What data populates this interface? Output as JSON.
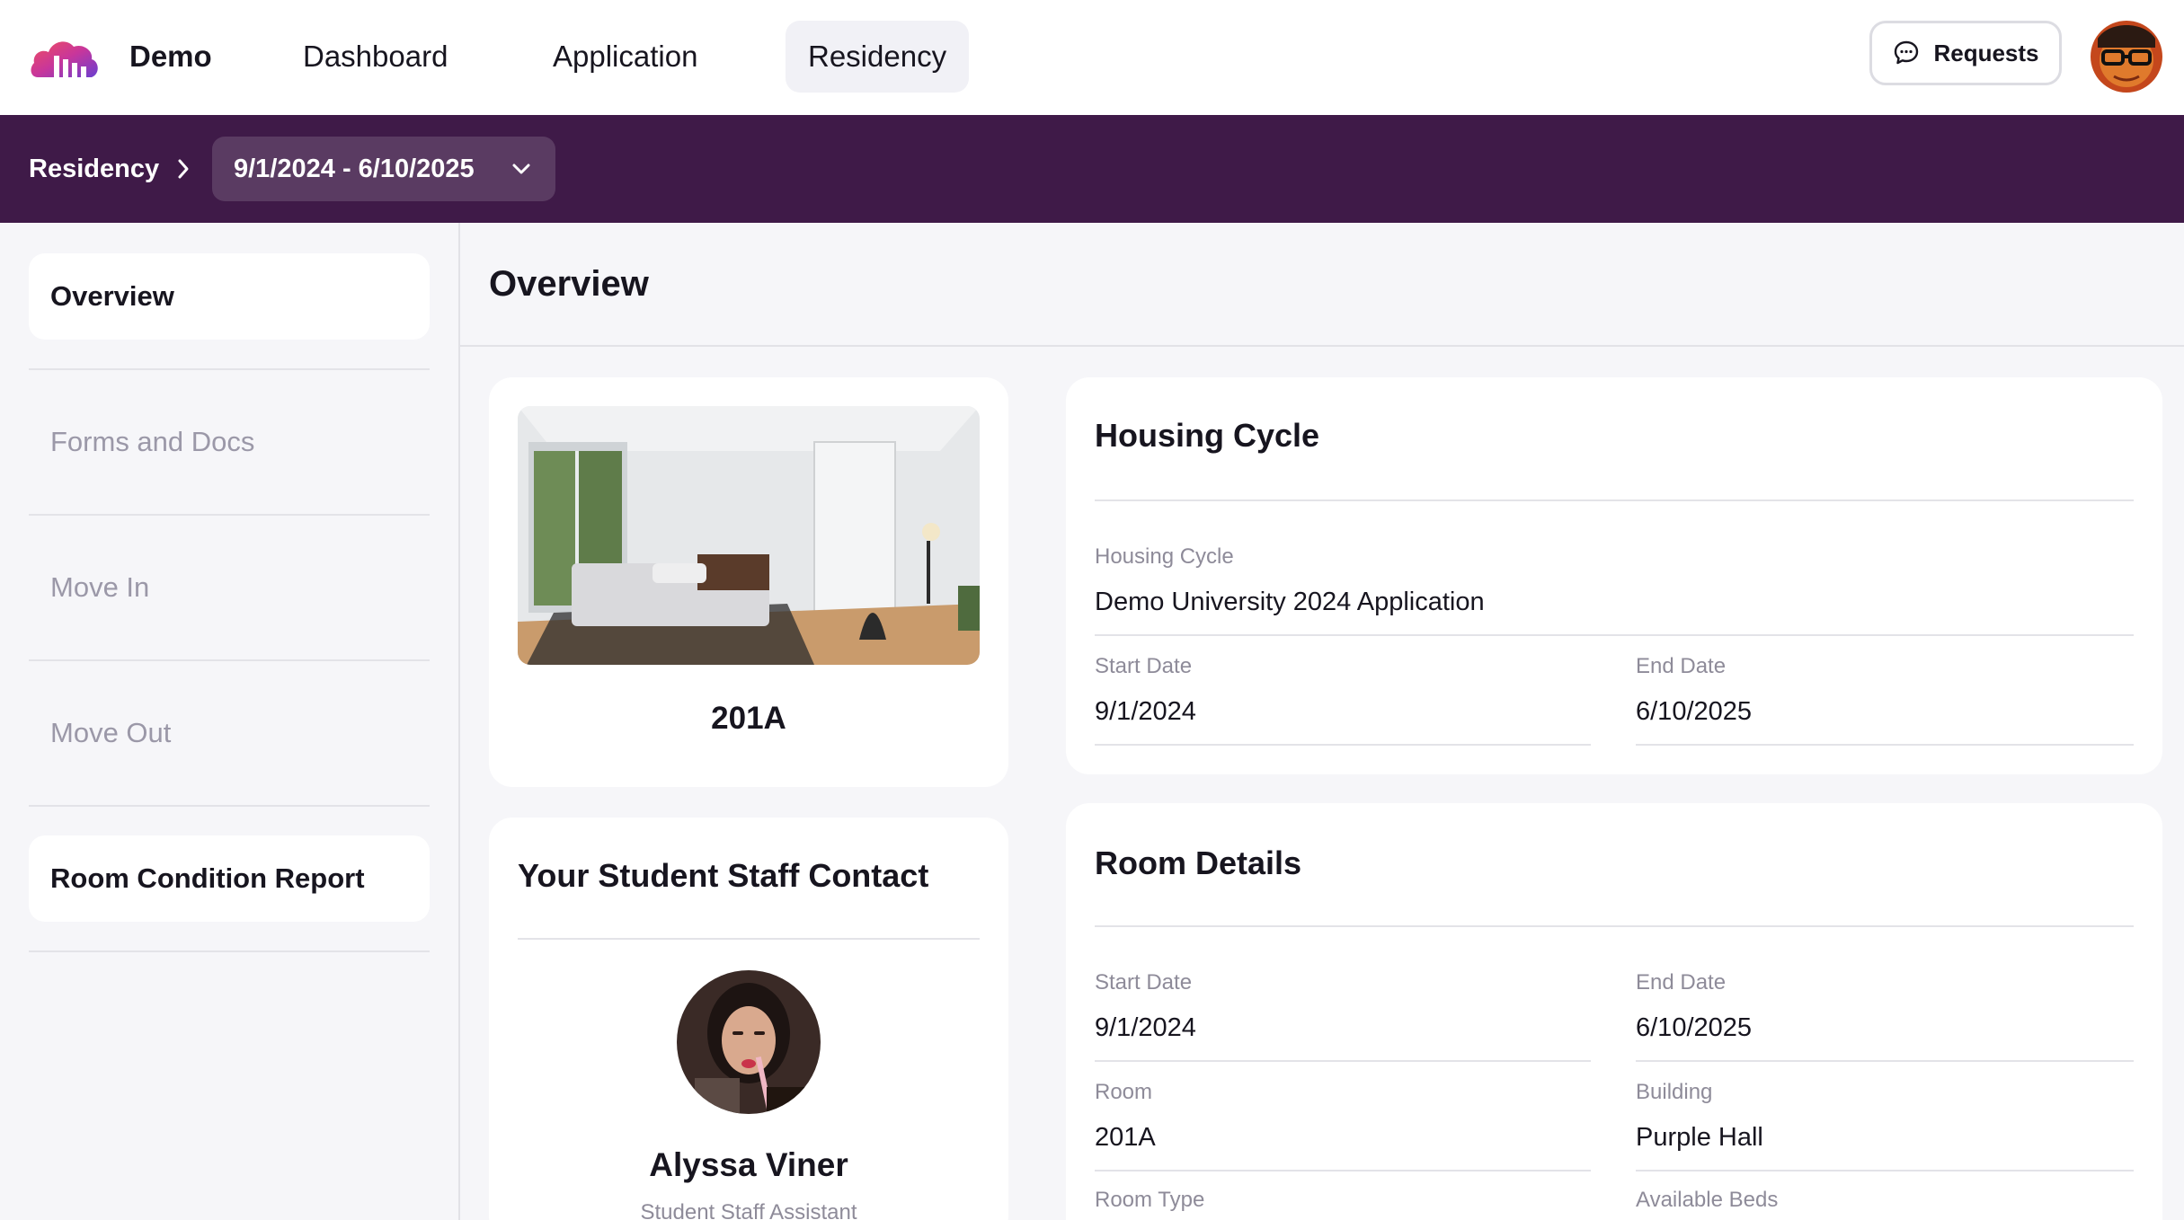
{
  "nav": {
    "brand": "Demo",
    "items": [
      {
        "label": "Dashboard"
      },
      {
        "label": "Application"
      },
      {
        "label": "Residency",
        "active": true
      }
    ],
    "requests_label": "Requests"
  },
  "subbar": {
    "crumb": "Residency",
    "cycle_range": "9/1/2024 - 6/10/2025"
  },
  "sidebar": {
    "items": [
      {
        "label": "Overview",
        "state": "active"
      },
      {
        "label": "Forms and Docs",
        "state": "disabled"
      },
      {
        "label": "Move In",
        "state": "disabled"
      },
      {
        "label": "Move Out",
        "state": "disabled"
      },
      {
        "label": "Room Condition Report",
        "state": "active"
      }
    ]
  },
  "main": {
    "title": "Overview",
    "room_card": {
      "room_name": "201A"
    },
    "staff_card": {
      "title": "Your Student Staff Contact",
      "name": "Alyssa Viner",
      "role": "Student Staff Assistant"
    },
    "housing_cycle": {
      "title": "Housing Cycle",
      "cycle_label": "Housing Cycle",
      "cycle_value": "Demo University 2024 Application",
      "start_label": "Start Date",
      "start_value": "9/1/2024",
      "end_label": "End Date",
      "end_value": "6/10/2025"
    },
    "room_details": {
      "title": "Room Details",
      "start_label": "Start Date",
      "start_value": "9/1/2024",
      "end_label": "End Date",
      "end_value": "6/10/2025",
      "room_label": "Room",
      "room_value": "201A",
      "building_label": "Building",
      "building_value": "Purple Hall",
      "room_type_label": "Room Type",
      "available_beds_label": "Available Beds"
    }
  },
  "colors": {
    "brand_purple": "#3f1a48",
    "select_purple": "#5a3b62",
    "page_bg": "#f6f6f9",
    "muted_text": "#9b98a8"
  },
  "icons": {
    "logo": "cloud-buildings-logo",
    "breadcrumb": "chevron-right-icon",
    "select": "chevron-down-icon",
    "requests": "chat-bubble-icon"
  }
}
